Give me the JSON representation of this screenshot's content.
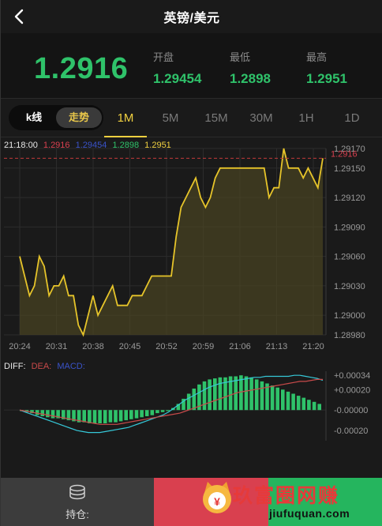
{
  "header": {
    "title": "英镑/美元"
  },
  "price": {
    "current": "1.2916",
    "stats": [
      {
        "label": "开盘",
        "value": "1.29454"
      },
      {
        "label": "最低",
        "value": "1.2898"
      },
      {
        "label": "最高",
        "value": "1.2951"
      }
    ]
  },
  "tabs": {
    "mode": [
      "k线",
      "走势"
    ],
    "mode_active": "走势",
    "timeframes": [
      "1M",
      "5M",
      "15M",
      "30M",
      "1H",
      "1D"
    ],
    "timeframe_active": "1M"
  },
  "chart_info": {
    "time": "21:18:00",
    "v1": "1.2916",
    "v2": "1.29454",
    "v3": "1.2898",
    "v4": "1.2951"
  },
  "macd_labels": {
    "diff": "DIFF:",
    "dea": "DEA:",
    "macd": "MACD:"
  },
  "chart_data": [
    {
      "type": "area",
      "x": [
        "20:24",
        "20:31",
        "20:38",
        "20:45",
        "20:52",
        "20:59",
        "21:06",
        "21:13",
        "21:20"
      ],
      "xtick_labels": [
        "20:24",
        "20:31",
        "20:38",
        "20:45",
        "20:52",
        "20:59",
        "21:06",
        "21:13",
        "21:20"
      ],
      "ytick_labels": [
        "1.29170",
        "1.29150",
        "1.29120",
        "1.29090",
        "1.29060",
        "1.29030",
        "1.29000",
        "1.28980"
      ],
      "ylim": [
        1.2898,
        1.2917
      ],
      "last_price_label": "1.2916",
      "series": [
        {
          "values": [
            1.2906,
            1.2904,
            1.2902,
            1.2903,
            1.2906,
            1.2905,
            1.2902,
            1.2903,
            1.2903,
            1.2904,
            1.2902,
            1.2902,
            1.2899,
            1.2898,
            1.29,
            1.2902,
            1.29,
            1.2901,
            1.2902,
            1.2903,
            1.2901,
            1.2901,
            1.2901,
            1.2902,
            1.2902,
            1.2902,
            1.2903,
            1.2904,
            1.2904,
            1.2904,
            1.2904,
            1.2904,
            1.2908,
            1.2911,
            1.2912,
            1.2913,
            1.2914,
            1.2912,
            1.2911,
            1.2912,
            1.2914,
            1.2915,
            1.2915,
            1.2915,
            1.2915,
            1.2915,
            1.2915,
            1.2915,
            1.2915,
            1.2915,
            1.2915,
            1.2912,
            1.2913,
            1.2913,
            1.2917,
            1.2915,
            1.2915,
            1.2915,
            1.2914,
            1.2915,
            1.2914,
            1.2913,
            1.2916
          ]
        }
      ],
      "colors": {
        "line": "#e6c42a",
        "fill": "#4a4422",
        "last_price": "#c23a3a",
        "grid": "#2c2c2c"
      }
    },
    {
      "type": "bar",
      "ytick_labels": [
        "+0.00034",
        "+0.00020",
        "-0.00000",
        "-0.00020"
      ],
      "ylim": [
        -0.0003,
        0.00038
      ],
      "macd": [
        -1e-05,
        -2e-05,
        -3e-05,
        -5e-05,
        -6e-05,
        -7e-05,
        -8e-05,
        -8e-05,
        -9e-05,
        -0.0001,
        -0.00011,
        -0.00012,
        -0.00012,
        -0.00013,
        -0.00013,
        -0.00013,
        -0.00013,
        -0.00012,
        -0.00012,
        -0.00011,
        -0.0001,
        -9e-05,
        -8e-05,
        -7e-05,
        -6e-05,
        -5e-05,
        -3e-05,
        -2e-05,
        -1e-05,
        2e-05,
        6e-05,
        0.00011,
        0.00016,
        0.00021,
        0.00025,
        0.00028,
        0.0003,
        0.00031,
        0.00032,
        0.00032,
        0.00033,
        0.00033,
        0.00034,
        0.00033,
        0.00032,
        0.0003,
        0.00028,
        0.00026,
        0.00024,
        0.00022,
        0.0002,
        0.00018,
        0.00016,
        0.00014,
        0.00012,
        0.0001,
        8e-05,
        6e-05
      ],
      "diff": [
        0.0,
        -2e-05,
        -4e-05,
        -6e-05,
        -8e-05,
        -0.0001,
        -0.00012,
        -0.00014,
        -0.00016,
        -0.00018,
        -0.0002,
        -0.00021,
        -0.00022,
        -0.00022,
        -0.00022,
        -0.00021,
        -0.0002,
        -0.00019,
        -0.00018,
        -0.00017,
        -0.00015,
        -0.00013,
        -0.00011,
        -9e-05,
        -7e-05,
        -5e-05,
        -2e-05,
        2e-05,
        6e-05,
        0.0001,
        0.00013,
        0.00016,
        0.00019,
        0.00022,
        0.00024,
        0.00026,
        0.00027,
        0.00028,
        0.00029,
        0.0003,
        0.00031,
        0.00032,
        0.00032,
        0.00033,
        0.00033,
        0.00033,
        0.00033,
        0.00033,
        0.00034,
        0.00034,
        0.00033,
        0.00032,
        0.00031,
        0.00029
      ],
      "dea": [
        0.0,
        -1e-05,
        -2e-05,
        -3e-05,
        -4e-05,
        -5e-05,
        -6e-05,
        -7e-05,
        -8e-05,
        -9e-05,
        -0.0001,
        -0.00011,
        -0.00012,
        -0.00013,
        -0.00014,
        -0.00014,
        -0.00014,
        -0.00014,
        -0.00013,
        -0.00012,
        -0.00011,
        -0.0001,
        -9e-05,
        -8e-05,
        -7e-05,
        -6e-05,
        -5e-05,
        -4e-05,
        -3e-05,
        -1e-05,
        1e-05,
        3e-05,
        5e-05,
        7e-05,
        9e-05,
        0.00011,
        0.00013,
        0.00015,
        0.00017,
        0.00018,
        0.00019,
        0.0002,
        0.00021,
        0.00022,
        0.00023,
        0.00024,
        0.00025,
        0.00026,
        0.00027,
        0.00028,
        0.00028,
        0.00029,
        0.0003,
        0.0003
      ],
      "colors": {
        "up": "#2fc26a",
        "down": "#2fc26a",
        "diff": "#36c8d8",
        "dea": "#c94a4a"
      }
    }
  ],
  "bottom": {
    "hold_label": "持仓:"
  },
  "watermark": {
    "cn": "玖富圈网赚",
    "url": "jiufuquan.com"
  },
  "icons": [
    "back-arrow-icon",
    "coin-stack-icon"
  ],
  "colors": {
    "accent": "#f0d040",
    "green": "#2fc26a",
    "red": "#d9404f"
  }
}
